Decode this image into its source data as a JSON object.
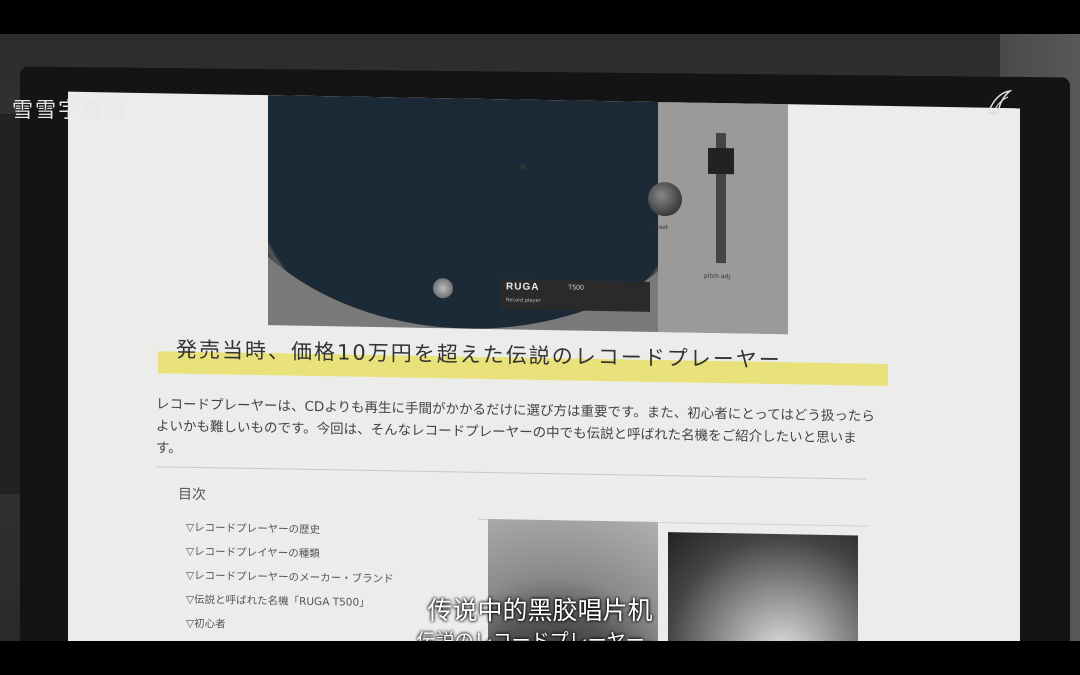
{
  "watermark": "雪雪字幕组",
  "hero": {
    "brand": "RUGA",
    "model": "T500",
    "brand_sub": "Record player",
    "reset_label": "reset",
    "pitch_label": "pitch adj."
  },
  "article": {
    "title": "発売当時、価格10万円を超えた伝説のレコードプレーヤー",
    "intro": "レコードプレーヤーは、CDよりも再生に手間がかかるだけに選び方は重要です。また、初心者にとってはどう扱ったらよいかも難しいものです。今回は、そんなレコードプレーヤーの中でも伝説と呼ばれた名機をご紹介したいと思います。",
    "toc_title": "目次",
    "toc_items": [
      "▽レコードプレーヤーの歴史",
      "▽レコードプレイヤーの種類",
      "▽レコードプレーヤーのメーカー・ブランド",
      "▽伝説と呼ばれた名機「RUGA T500」",
      "▽初心者"
    ]
  },
  "subtitles": {
    "chinese": "传说中的黑胶唱片机",
    "japanese": "伝説のレコードプレーヤー。"
  },
  "colors": {
    "highlight": "#e9e27a",
    "page_bg": "#ecedeb"
  }
}
